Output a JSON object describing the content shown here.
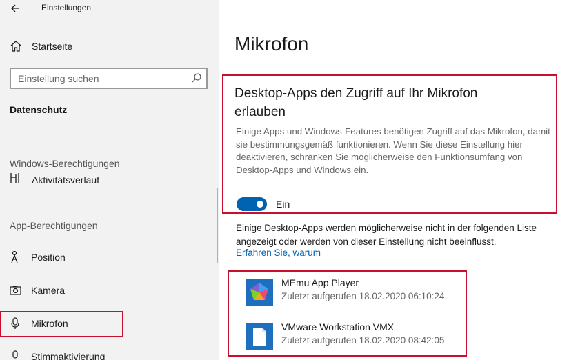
{
  "window": {
    "title": "Einstellungen"
  },
  "sidebar": {
    "home_label": "Startseite",
    "search_placeholder": "Einstellung suchen",
    "category": "Datenschutz",
    "windows_permissions_heading": "Windows-Berechtigungen",
    "partial_item_label": "Aktivitätsverlauf",
    "app_permissions_heading": "App-Berechtigungen",
    "items": [
      {
        "label": "Position",
        "icon": "location-icon"
      },
      {
        "label": "Kamera",
        "icon": "camera-icon"
      },
      {
        "label": "Mikrofon",
        "icon": "microphone-icon"
      },
      {
        "label": "Stimmaktivierung",
        "icon": "voice-activation-icon"
      }
    ],
    "highlight_color": "#c8102e"
  },
  "main": {
    "title": "Mikrofon",
    "card": {
      "heading": "Desktop-Apps den Zugriff auf Ihr Mikrofon erlauben",
      "description": "Einige Apps und Windows-Features benötigen Zugriff auf das Mikrofon, damit sie bestimmungsgemäß funktionieren. Wenn Sie diese Einstellung hier deaktivieren, schränken Sie möglicherweise den Funktionsumfang von Desktop-Apps und Windows ein.",
      "toggle_state": "on",
      "toggle_label": "Ein",
      "accent_color": "#0063b1"
    },
    "info_text": "Einige Desktop-Apps werden möglicherweise nicht in der folgenden Liste angezeigt oder werden von dieser Einstellung nicht beeinflusst.",
    "learn_more_link": "Erfahren Sie, warum",
    "apps": [
      {
        "name": "MEmu App Player",
        "last_accessed": "Zuletzt aufgerufen 18.02.2020 06:10:24",
        "icon": "memu-app-icon"
      },
      {
        "name": "VMware Workstation VMX",
        "last_accessed": "Zuletzt aufgerufen 18.02.2020 08:42:05",
        "icon": "vmware-file-icon"
      }
    ]
  }
}
